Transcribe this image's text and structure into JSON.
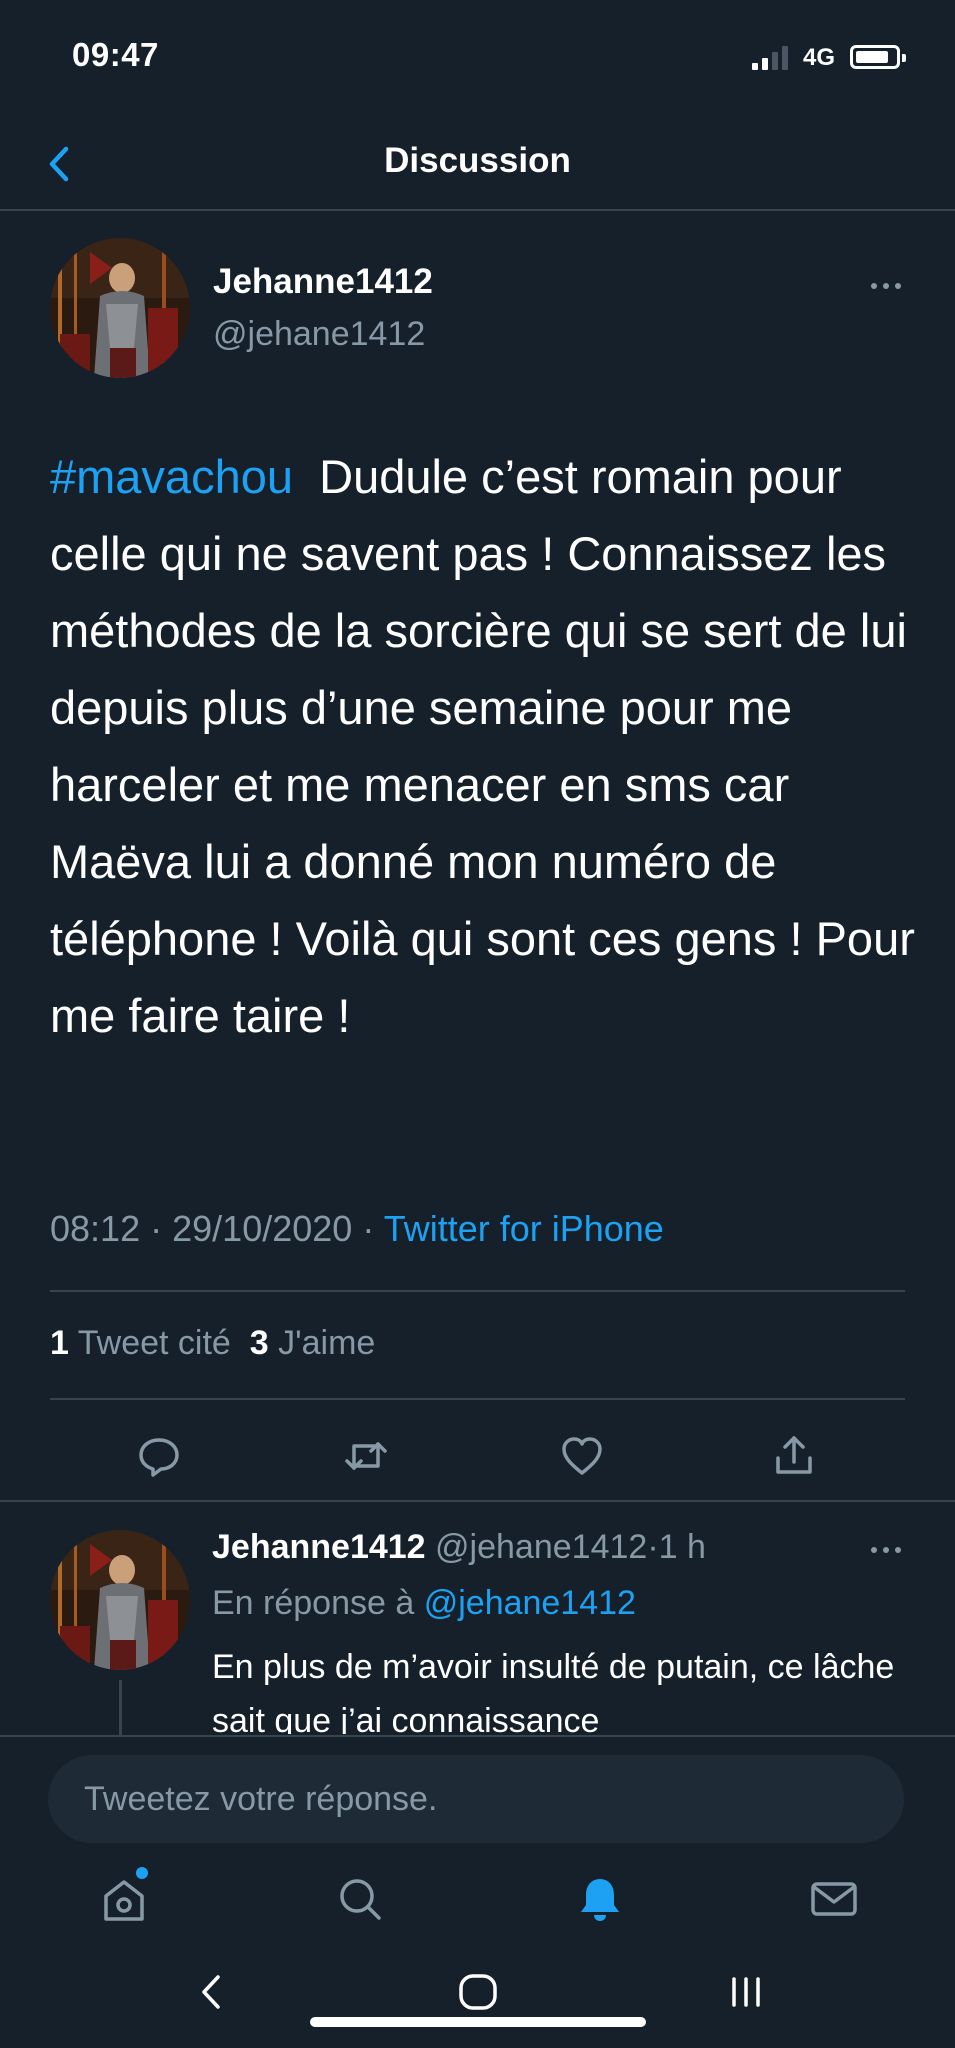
{
  "status_bar": {
    "time": "09:47",
    "network": "4G",
    "signal_bars_active": 2,
    "signal_bars_total": 4,
    "battery_level": 0.85
  },
  "header": {
    "title": "Discussion",
    "back_icon": "chevron-left-icon"
  },
  "tweet": {
    "author": {
      "name": "Jehanne1412",
      "handle": "@jehane1412",
      "avatar_icon": "avatar-painting"
    },
    "more_icon": "more-horizontal-icon",
    "hashtag": "#mavachou",
    "text": "Dudule c’est romain pour celle qui ne savent pas ! Connaissez les méthodes de la sorcière qui se sert de lui depuis plus d’une semaine pour me harceler et me menacer en sms car Maëva lui a donné mon numéro de téléphone ! Voilà qui sont ces gens ! Pour me faire taire !",
    "time": "08:12",
    "separator": "·",
    "date": "29/10/2020",
    "source": "Twitter for iPhone",
    "stats": {
      "quotes_count": "1",
      "quotes_label": "Tweet cité",
      "likes_count": "3",
      "likes_label": "J'aime"
    },
    "actions": [
      {
        "name": "reply",
        "icon": "reply-icon"
      },
      {
        "name": "retweet",
        "icon": "retweet-icon"
      },
      {
        "name": "like",
        "icon": "heart-icon"
      },
      {
        "name": "share",
        "icon": "share-icon"
      }
    ]
  },
  "reply": {
    "name": "Jehanne1412",
    "handle": "@jehane1412",
    "separator": "·",
    "time": "1 h",
    "reply_prefix": "En réponse à",
    "reply_mention": "@jehane1412",
    "text": "En plus de m’avoir insulté de putain, ce lâche sait que j’ai connaissance"
  },
  "compose": {
    "placeholder": "Tweetez votre réponse."
  },
  "tab_bar": {
    "tabs": [
      {
        "name": "home",
        "icon": "home-icon",
        "active": false,
        "has_dot": true
      },
      {
        "name": "search",
        "icon": "search-icon",
        "active": false
      },
      {
        "name": "notifications",
        "icon": "bell-icon",
        "active": true
      },
      {
        "name": "messages",
        "icon": "mail-icon",
        "active": false
      }
    ]
  },
  "system_nav": {
    "buttons": [
      "back-icon",
      "home-button-icon",
      "recents-icon"
    ]
  },
  "colors": {
    "background": "#15202b",
    "accent": "#1da1f2",
    "secondary_text": "#8899a6",
    "divider": "#38444d"
  }
}
